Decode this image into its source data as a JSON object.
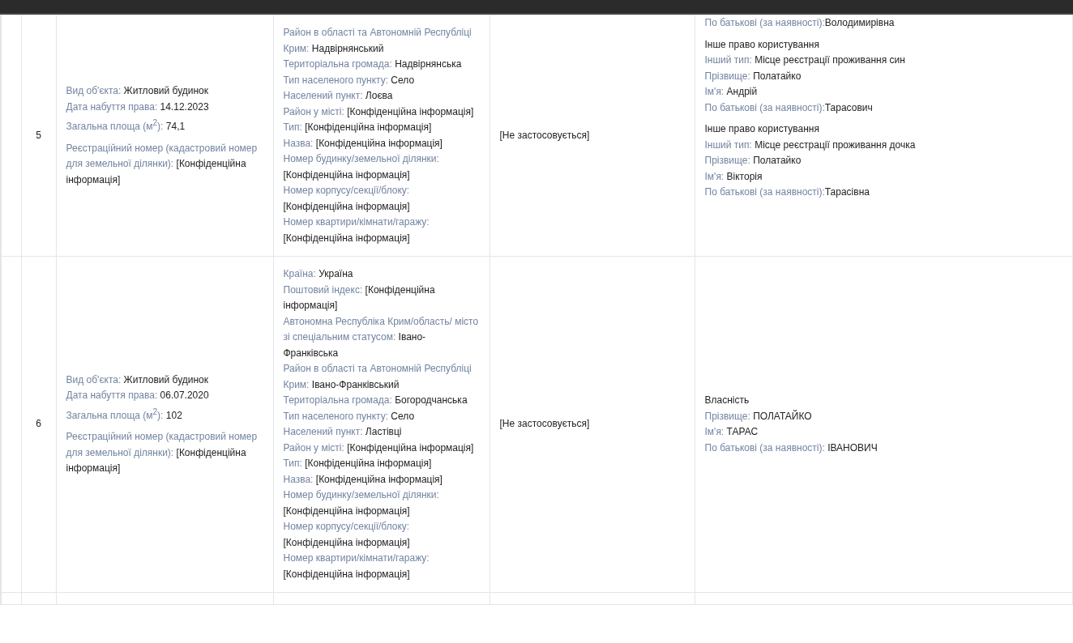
{
  "rows": [
    {
      "number": "5",
      "object": [
        {
          "fields": [
            {
              "label": "Вид об'єкта: ",
              "value": "Житловий будинок"
            },
            {
              "label": "Дата набуття права: ",
              "value": "14.12.2023"
            },
            {
              "label": "Загальна площа (м$^{2}$): ",
              "value": "74,1"
            }
          ]
        },
        {
          "fields": [
            {
              "label": "Реєстраційний номер (кадастровий номер для земельної ділянки): ",
              "value": "[Конфіденційна інформація]"
            }
          ]
        }
      ],
      "address": [
        {
          "label": "Район в області та Автономній Республіці Крим: ",
          "value": "Надвірнянський"
        },
        {
          "label": "Територіальна громада: ",
          "value": "Надвірнянська"
        },
        {
          "label": "Тип населеного пункту: ",
          "value": "Село"
        },
        {
          "label": "Населений пункт: ",
          "value": "Лоєва"
        },
        {
          "label": "Район у місті: ",
          "value": "[Конфіденційна інформація]"
        },
        {
          "label": "Тип: ",
          "value": "[Конфіденційна інформація]"
        },
        {
          "label": "Назва: ",
          "value": "[Конфіденційна інформація]"
        },
        {
          "label": "Номер будинку/земельної ділянки: ",
          "value": "[Конфіденційна інформація]"
        },
        {
          "label": "Номер корпусу/секції/блоку: ",
          "value": "[Конфіденційна інформація]"
        },
        {
          "label": "Номер квартири/кімнати/гаражу: ",
          "value": "[Конфіденційна інформація]"
        }
      ],
      "column_4": "[Не застосовується]",
      "rights": [
        {
          "fields": [
            {
              "label": "По батькові (за наявності):",
              "value": "Володимирівна"
            }
          ]
        },
        {
          "title": "Інше право користування",
          "fields": [
            {
              "label": "Інший тип: ",
              "value": "Місце реєстрації проживання син"
            },
            {
              "label": "Прізвище: ",
              "value": "Полатайко"
            },
            {
              "label": "Ім'я: ",
              "value": "Андрій"
            },
            {
              "label": "По батькові (за наявності):",
              "value": "Тарасович"
            }
          ]
        },
        {
          "title": "Інше право користування",
          "fields": [
            {
              "label": "Інший тип: ",
              "value": "Місце реєстрації проживання дочка"
            },
            {
              "label": "Прізвище: ",
              "value": "Полатайко"
            },
            {
              "label": "Ім'я: ",
              "value": "Вікторія"
            },
            {
              "label": "По батькові (за наявності):",
              "value": "Тарасівна"
            }
          ]
        }
      ]
    },
    {
      "number": "6",
      "object": [
        {
          "fields": [
            {
              "label": "Вид об'єкта: ",
              "value": "Житловий будинок"
            },
            {
              "label": "Дата набуття права: ",
              "value": "06.07.2020"
            },
            {
              "label": "Загальна площа (м$^{2}$): ",
              "value": "102"
            }
          ]
        },
        {
          "fields": [
            {
              "label": "Реєстраційний номер (кадастровий номер для земельної ділянки): ",
              "value": "[Конфіденційна інформація]"
            }
          ]
        }
      ],
      "address": [
        {
          "label": "Країна: ",
          "value": "Україна"
        },
        {
          "label": "Поштовий індекс: ",
          "value": "[Конфіденційна інформація]"
        },
        {
          "label": "Автономна Республіка Крим/область/ місто зі спеціальним статусом: ",
          "value": "Івано-Франківська"
        },
        {
          "label": "Район в області та Автономній Республіці Крим: ",
          "value": "Івано-Франківський"
        },
        {
          "label": "Територіальна громада: ",
          "value": "Богородчанська"
        },
        {
          "label": "Тип населеного пункту: ",
          "value": "Село"
        },
        {
          "label": "Населений пункт: ",
          "value": "Ластівці"
        },
        {
          "label": "Район у місті: ",
          "value": "[Конфіденційна інформація]"
        },
        {
          "label": "Тип: ",
          "value": "[Конфіденційна інформація]"
        },
        {
          "label": "Назва: ",
          "value": "[Конфіденційна інформація]"
        },
        {
          "label": "Номер будинку/земельної ділянки: ",
          "value": "[Конфіденційна інформація]"
        },
        {
          "label": "Номер корпусу/секції/блоку: ",
          "value": "[Конфіденційна інформація]"
        },
        {
          "label": "Номер квартири/кімнати/гаражу: ",
          "value": "[Конфіденційна інформація]"
        }
      ],
      "column_4": "[Не застосовується]",
      "rights": [
        {
          "title": "Власність",
          "fields": [
            {
              "label": "Прізвище: ",
              "value": "ПОЛАТАЙКО"
            },
            {
              "label": "Ім'я: ",
              "value": "ТАРАС"
            },
            {
              "label": "По батькові (за наявності): ",
              "value": "ІВАНОВИЧ"
            }
          ]
        }
      ]
    }
  ]
}
